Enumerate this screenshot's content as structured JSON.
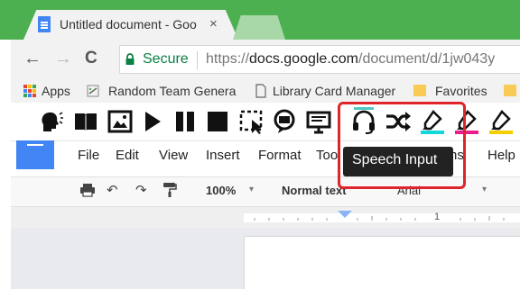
{
  "browser": {
    "tab_title": "Untitled document - Goo",
    "tab_close": "×",
    "nav": {
      "back": "←",
      "forward": "→",
      "reload": "C"
    },
    "secure_label": "Secure",
    "url_main": "https://docs.google.com/document/d/1jw043y",
    "url_scheme": "https://",
    "url_host": "docs.google.com",
    "url_path": "/document/d/1jw043y"
  },
  "bookmarks": [
    {
      "label": "Apps",
      "icon": "apps-grid-icon"
    },
    {
      "label": "Random Team Genera",
      "icon": "random-icon"
    },
    {
      "label": "Library Card Manager",
      "icon": "page-icon"
    },
    {
      "label": "Favorites",
      "icon": "folder-icon"
    }
  ],
  "extension_toolbar": {
    "buttons": [
      "talking-head-icon",
      "book-icon",
      "picture-icon",
      "play-icon",
      "pause-icon",
      "stop-icon",
      "screen-select-icon",
      "speech-bubble-icon",
      "monitor-icon",
      "headset-icon",
      "shuffle-icon",
      "highlighter-cyan-icon",
      "highlighter-magenta-icon",
      "highlighter-yellow-icon"
    ],
    "active": "headset-icon",
    "tooltip": "Speech Input",
    "colors": {
      "cyan": "#13d6d9",
      "magenta": "#e91e8c",
      "yellow": "#f5d000",
      "active_bar": "#4cc9c4",
      "highlight_box": "#e0242b"
    }
  },
  "docs_menu": {
    "items": [
      "File",
      "Edit",
      "View",
      "Insert",
      "Format",
      "Too",
      "ns",
      "Help"
    ]
  },
  "format_toolbar": {
    "zoom": "100%",
    "style": "Normal text",
    "font": "Arial"
  },
  "ruler": {
    "mark": "1"
  },
  "colors": {
    "tabstrip": "#4caf50",
    "docs_blue": "#4285f4",
    "secure_green": "#0b8043"
  }
}
